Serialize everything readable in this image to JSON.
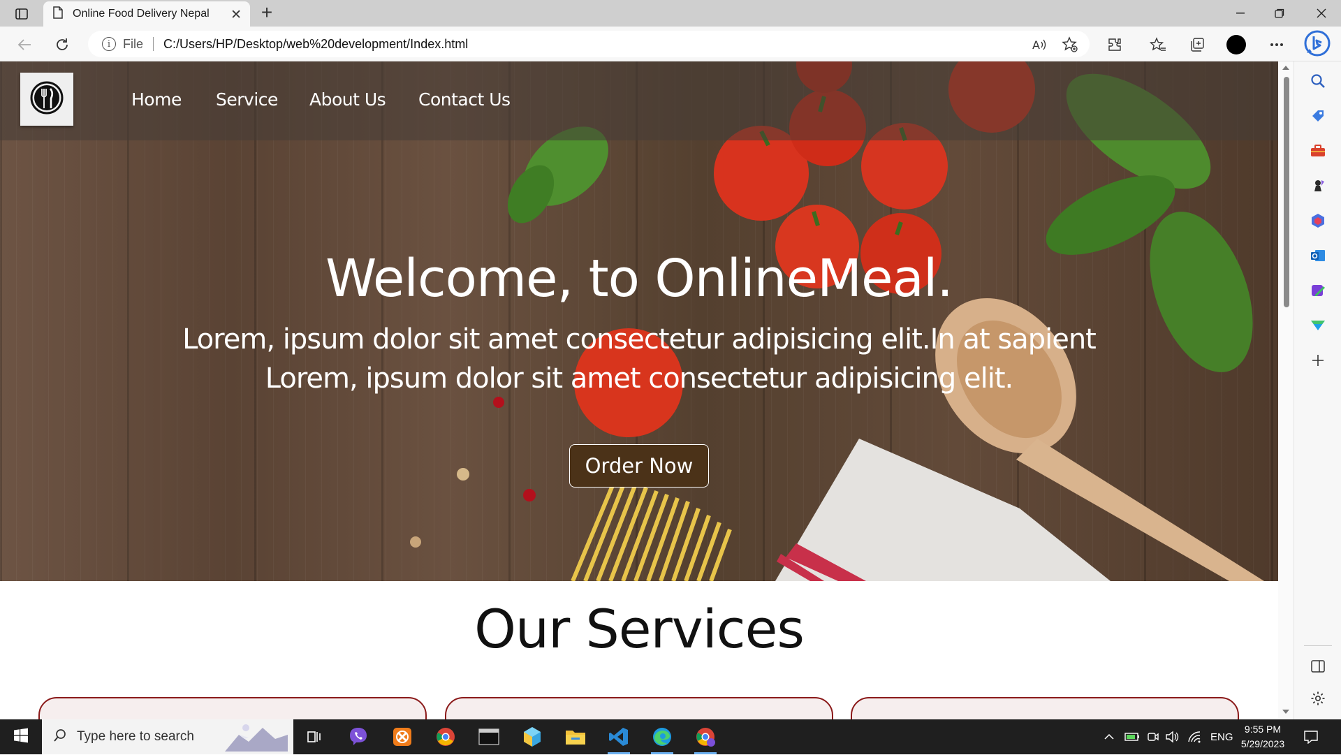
{
  "browser": {
    "tab_title": "Online Food Delivery Nepal",
    "address_prefix": "File",
    "url": "C:/Users/HP/Desktop/web%20development/Index.html"
  },
  "site": {
    "nav": [
      "Home",
      "Service",
      "About Us",
      "Contact Us"
    ],
    "hero_title": "Welcome, to OnlineMeal.",
    "hero_line1": "Lorem, ipsum dolor sit amet consectetur adipisicing elit.In at sapient",
    "hero_line2": "Lorem, ipsum dolor sit amet consectetur adipisicing elit.",
    "order_button": "Order Now",
    "services_title": "Our Services"
  },
  "taskbar": {
    "search_placeholder": "Type here to search",
    "language": "ENG",
    "time": "9:55 PM",
    "date": "5/29/2023"
  },
  "colors": {
    "order_button_bg": "#4b3218",
    "card_border": "#8b1a1a",
    "taskbar_bg": "#1f1f1f"
  }
}
